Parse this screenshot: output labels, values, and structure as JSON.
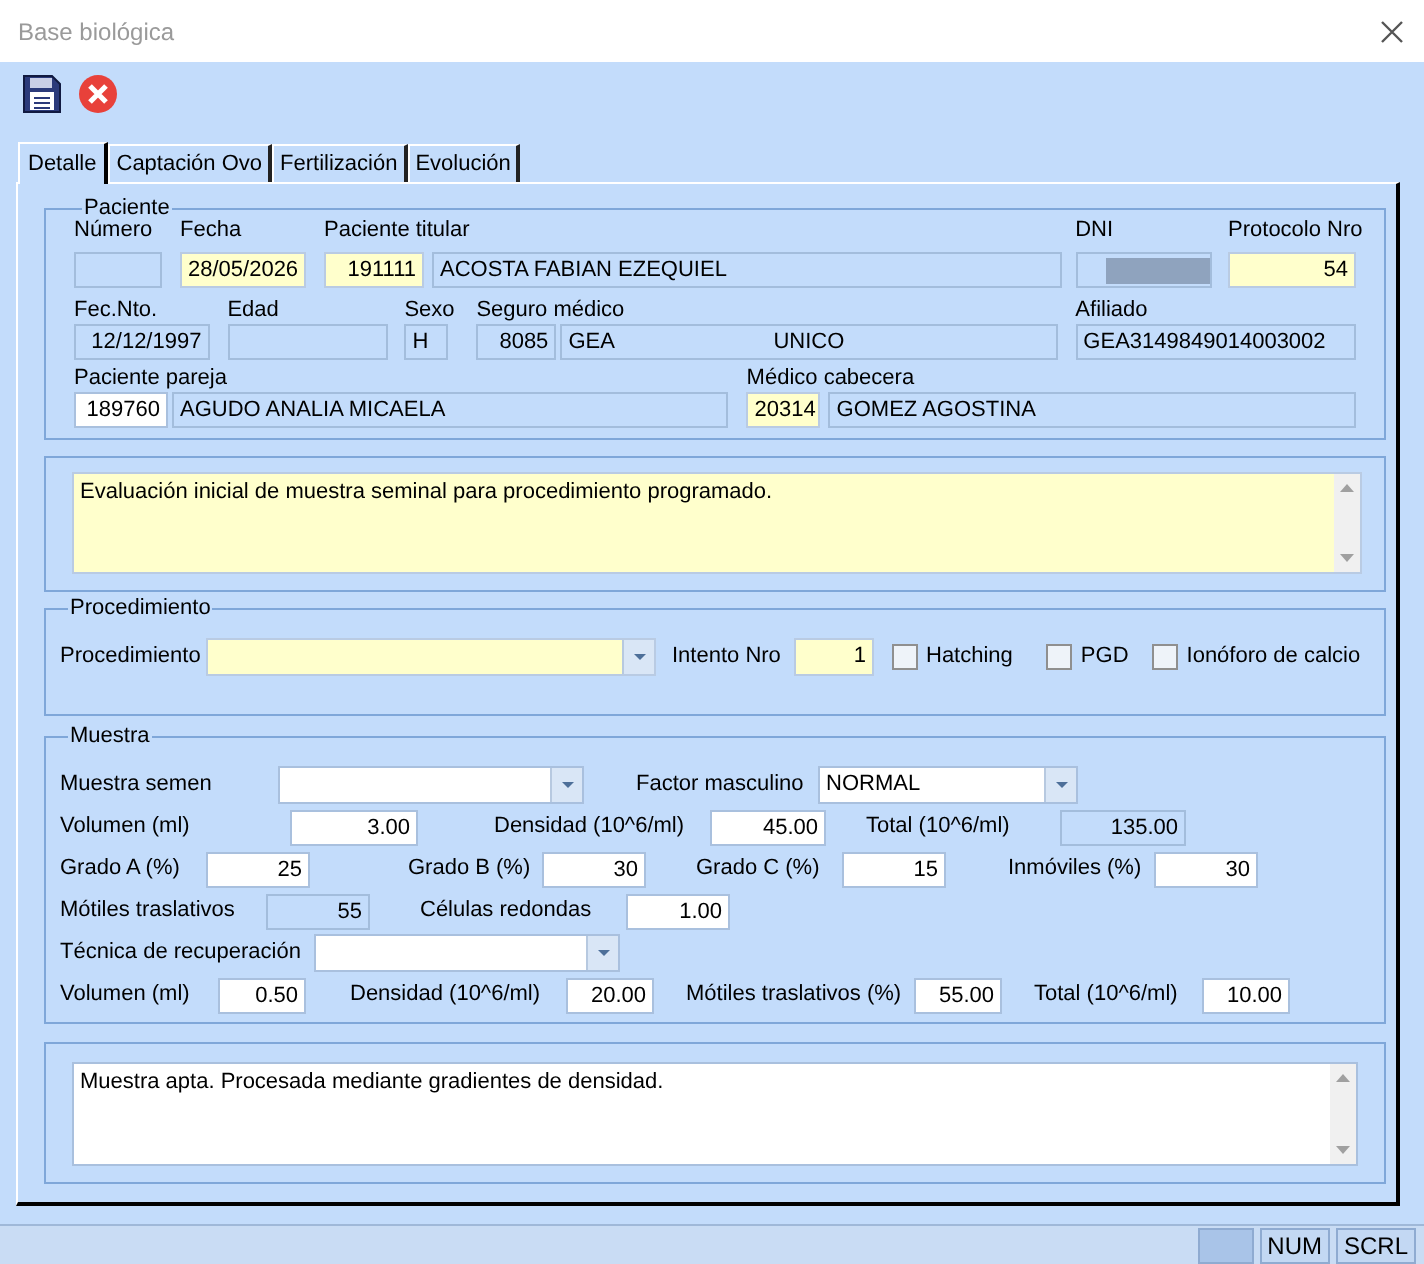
{
  "window": {
    "title": "Base biológica"
  },
  "toolbar": [
    {
      "kind": "save"
    },
    {
      "kind": "cancel"
    }
  ],
  "tabs": [
    {
      "label": "Detalle",
      "selected": true
    },
    {
      "label": "Captación Ovo",
      "selected": false
    },
    {
      "label": "Fertilización",
      "selected": false
    },
    {
      "label": "Evolución",
      "selected": false
    }
  ],
  "paciente": {
    "title": "Paciente",
    "fields": [
      {
        "label": "Número",
        "kind": "text",
        "required": false,
        "readonly": true
      },
      {
        "label": "Fecha",
        "kind": "text",
        "required": true,
        "readonly": false,
        "value": "28/05/2026"
      },
      {
        "label": "Paciente titular",
        "kind": "lookup",
        "required": true,
        "readonly": false,
        "code": "191111",
        "name": "ACOSTA FABIAN EZEQUIEL"
      },
      {
        "label": "DNI",
        "kind": "text",
        "required": false,
        "readonly": true,
        "masked": true
      },
      {
        "label": "Protocolo Nro",
        "kind": "text",
        "required": true,
        "readonly": false,
        "value": "54"
      },
      {
        "label": "Fec.Nto.",
        "kind": "text",
        "required": false,
        "readonly": true,
        "value": "12/12/1997"
      },
      {
        "label": "Edad",
        "kind": "text",
        "required": false,
        "readonly": true
      },
      {
        "label": "Sexo",
        "kind": "text",
        "required": false,
        "readonly": true,
        "value": "H"
      },
      {
        "label": "Seguro médico",
        "kind": "lookup",
        "required": false,
        "readonly": true,
        "code": "8085",
        "name": "GEA",
        "plan": "UNICO"
      },
      {
        "label": "Afiliado",
        "kind": "text",
        "required": false,
        "readonly": true,
        "value": "GEA3149849014003002"
      },
      {
        "label": "Paciente pareja",
        "kind": "lookup",
        "required": false,
        "readonly": false,
        "code": "189760",
        "name": "AGUDO ANALIA MICAELA"
      },
      {
        "label": "Médico cabecera",
        "kind": "lookup",
        "required": true,
        "readonly": false,
        "code": "20314",
        "name": "GOMEZ AGOSTINA"
      }
    ]
  },
  "observaciones": {
    "required": true,
    "readonly": false,
    "text": "Evaluación inicial de muestra seminal para procedimiento programado."
  },
  "procedimiento": {
    "title": "Procedimiento",
    "fields": [
      {
        "label": "Procedimiento",
        "kind": "combo",
        "required": true,
        "readonly": false
      },
      {
        "label": "Intento Nro",
        "kind": "text",
        "required": true,
        "readonly": false,
        "value": "1"
      }
    ],
    "checks": [
      {
        "label": "Hatching",
        "checked": false
      },
      {
        "label": "PGD",
        "checked": false
      },
      {
        "label": "Ionóforo de calcio",
        "checked": false
      }
    ]
  },
  "muestra": {
    "title": "Muestra",
    "rows": [
      {
        "items": [
          {
            "label": "Muestra semen",
            "kind": "combo",
            "required": false,
            "readonly": false
          },
          {
            "label": "Factor masculino",
            "kind": "combo",
            "required": false,
            "readonly": false,
            "value": "NORMAL"
          }
        ]
      },
      {
        "items": [
          {
            "label": "Volumen (ml)",
            "kind": "text",
            "required": false,
            "readonly": false,
            "value": "3.00"
          },
          {
            "label": "Densidad (10^6/ml)",
            "kind": "text",
            "required": false,
            "readonly": false,
            "value": "45.00"
          },
          {
            "label": "Total (10^6/ml)",
            "kind": "text",
            "required": false,
            "readonly": true,
            "value": "135.00"
          }
        ]
      },
      {
        "items": [
          {
            "label": "Grado A (%)",
            "kind": "text",
            "required": false,
            "readonly": false,
            "value": "25"
          },
          {
            "label": "Grado B (%)",
            "kind": "text",
            "required": false,
            "readonly": false,
            "value": "30"
          },
          {
            "label": "Grado C (%)",
            "kind": "text",
            "required": false,
            "readonly": false,
            "value": "15"
          },
          {
            "label": "Inmóviles (%)",
            "kind": "text",
            "required": false,
            "readonly": false,
            "value": "30"
          }
        ]
      },
      {
        "items": [
          {
            "label": "Mótiles traslativos",
            "kind": "text",
            "required": false,
            "readonly": true,
            "value": "55"
          },
          {
            "label": "Células redondas",
            "kind": "text",
            "required": false,
            "readonly": false,
            "value": "1.00"
          }
        ]
      },
      {
        "items": [
          {
            "label": "Técnica de recuperación",
            "kind": "combo",
            "required": false,
            "readonly": false
          }
        ]
      },
      {
        "items": [
          {
            "label": "Volumen (ml)",
            "kind": "text",
            "required": false,
            "readonly": false,
            "value": "0.50"
          },
          {
            "label": "Densidad (10^6/ml)",
            "kind": "text",
            "required": false,
            "readonly": false,
            "value": "20.00"
          },
          {
            "label": "Mótiles traslativos (%)",
            "kind": "text",
            "required": false,
            "readonly": false,
            "value": "55.00"
          },
          {
            "label": "Total (10^6/ml)",
            "kind": "text",
            "required": false,
            "readonly": false,
            "value": "10.00"
          }
        ]
      }
    ]
  },
  "resultado": {
    "required": false,
    "readonly": false,
    "text": "Muestra apta. Procesada mediante gradientes de densidad."
  },
  "status_bar": [
    {
      "text": "NUM"
    },
    {
      "text": "SCRL"
    }
  ]
}
